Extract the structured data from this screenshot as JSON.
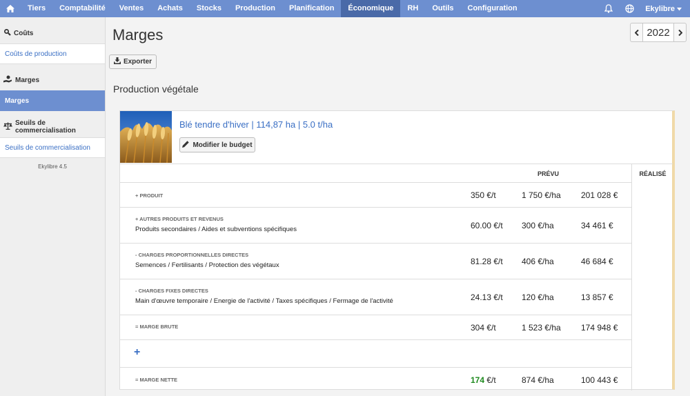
{
  "nav": {
    "items": [
      {
        "label": "Tiers",
        "active": false
      },
      {
        "label": "Comptabilité",
        "active": false
      },
      {
        "label": "Ventes",
        "active": false
      },
      {
        "label": "Achats",
        "active": false
      },
      {
        "label": "Stocks",
        "active": false
      },
      {
        "label": "Production",
        "active": false
      },
      {
        "label": "Planification",
        "active": false
      },
      {
        "label": "Économique",
        "active": true
      },
      {
        "label": "RH",
        "active": false
      },
      {
        "label": "Outils",
        "active": false
      },
      {
        "label": "Configuration",
        "active": false
      }
    ],
    "user": "Ekylibre",
    "accent": "#6d8fd0",
    "active_bg": "#4a6aa8"
  },
  "sidebar": {
    "sections": [
      {
        "heading": "Coûts",
        "icon": "search-icon",
        "link": "Coûts de production",
        "active": false
      },
      {
        "heading": "Marges",
        "icon": "hand-coin-icon",
        "link": "Marges",
        "active": true
      },
      {
        "heading": "Seuils de commercialisation",
        "icon": "scale-icon",
        "link": "Seuils de commercialisation",
        "active": false
      }
    ],
    "version": "Ekylibre 4.5"
  },
  "main": {
    "title": "Marges",
    "year": "2022",
    "export_label": "Exporter",
    "section_title": "Production végétale",
    "crop": {
      "title": "Blé tendre d'hiver | 114,87 ha | 5.0 t/ha",
      "budget_label": "Modifier le budget"
    },
    "table": {
      "prevu_header": "PRÉVU",
      "realise_header": "RÉALISÉ",
      "rows": [
        {
          "category": "+ Produit",
          "desc": "",
          "v1": "350",
          "v1_unit": " €/t",
          "v2": "1 750 €/ha",
          "v3": "201 028 €"
        },
        {
          "category": "+ Autres produits et revenus",
          "desc": "Produits secondaires / Aides et subventions spécifiques",
          "v1": "60.00",
          "v1_unit": " €/t",
          "v2": "300 €/ha",
          "v3": "34 461 €"
        },
        {
          "category": "- Charges proportionnelles directes",
          "desc": "Semences / Fertilisants / Protection des végétaux",
          "v1": "81.28",
          "v1_unit": " €/t",
          "v2": "406 €/ha",
          "v3": "46 684 €"
        },
        {
          "category": "- Charges fixes directes",
          "desc": "Main d'œuvre temporaire / Energie de l'activité / Taxes spécifiques / Fermage de l'activité",
          "v1": "24.13",
          "v1_unit": " €/t",
          "v2": "120 €/ha",
          "v3": "13 857 €"
        },
        {
          "category": "= Marge brute",
          "desc": "",
          "v1": "304",
          "v1_unit": " €/t",
          "v2": "1 523 €/ha",
          "v3": "174 948 €"
        },
        {
          "category": "= Marge nette",
          "desc": "",
          "v1": "174",
          "v1_unit": " €/t",
          "v2": "874 €/ha",
          "v3": "100 443 €"
        }
      ],
      "add_symbol": "+"
    }
  }
}
